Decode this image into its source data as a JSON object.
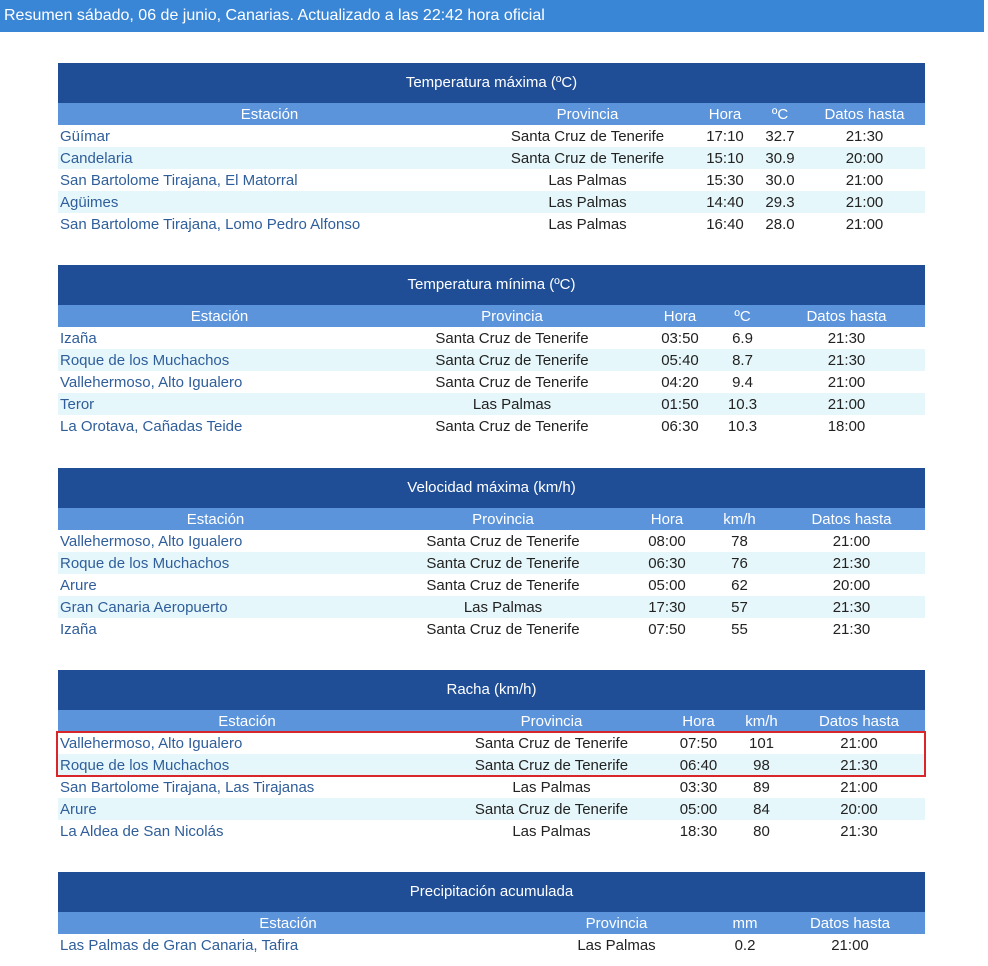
{
  "header": "Resumen sábado, 06 de junio, Canarias. Actualizado a las 22:42 hora oficial",
  "tmax": {
    "title": "Temperatura máxima (ºC)",
    "cols": [
      "Estación",
      "Provincia",
      "Hora",
      "ºC",
      "Datos hasta"
    ],
    "rows": [
      [
        "Güímar",
        "Santa Cruz de Tenerife",
        "17:10",
        "32.7",
        "21:30"
      ],
      [
        "Candelaria",
        "Santa Cruz de Tenerife",
        "15:10",
        "30.9",
        "20:00"
      ],
      [
        "San Bartolome Tirajana, El Matorral",
        "Las Palmas",
        "15:30",
        "30.0",
        "21:00"
      ],
      [
        "Agüimes",
        "Las Palmas",
        "14:40",
        "29.3",
        "21:00"
      ],
      [
        "San Bartolome Tirajana, Lomo Pedro Alfonso",
        "Las Palmas",
        "16:40",
        "28.0",
        "21:00"
      ]
    ]
  },
  "tmin": {
    "title": "Temperatura mínima (ºC)",
    "cols": [
      "Estación",
      "Provincia",
      "Hora",
      "ºC",
      "Datos hasta"
    ],
    "rows": [
      [
        "Izaña",
        "Santa Cruz de Tenerife",
        "03:50",
        "6.9",
        "21:30"
      ],
      [
        "Roque de los Muchachos",
        "Santa Cruz de Tenerife",
        "05:40",
        "8.7",
        "21:30"
      ],
      [
        "Vallehermoso, Alto Igualero",
        "Santa Cruz de Tenerife",
        "04:20",
        "9.4",
        "21:00"
      ],
      [
        "Teror",
        "Las Palmas",
        "01:50",
        "10.3",
        "21:00"
      ],
      [
        "La Orotava, Cañadas Teide",
        "Santa Cruz de Tenerife",
        "06:30",
        "10.3",
        "18:00"
      ]
    ]
  },
  "vmax": {
    "title": "Velocidad máxima (km/h)",
    "cols": [
      "Estación",
      "Provincia",
      "Hora",
      "km/h",
      "Datos hasta"
    ],
    "rows": [
      [
        "Vallehermoso, Alto Igualero",
        "Santa Cruz de Tenerife",
        "08:00",
        "78",
        "21:00"
      ],
      [
        "Roque de los Muchachos",
        "Santa Cruz de Tenerife",
        "06:30",
        "76",
        "21:30"
      ],
      [
        "Arure",
        "Santa Cruz de Tenerife",
        "05:00",
        "62",
        "20:00"
      ],
      [
        "Gran Canaria Aeropuerto",
        "Las Palmas",
        "17:30",
        "57",
        "21:30"
      ],
      [
        "Izaña",
        "Santa Cruz de Tenerife",
        "07:50",
        "55",
        "21:30"
      ]
    ]
  },
  "racha": {
    "title": "Racha (km/h)",
    "cols": [
      "Estación",
      "Provincia",
      "Hora",
      "km/h",
      "Datos hasta"
    ],
    "rows": [
      [
        "Vallehermoso, Alto Igualero",
        "Santa Cruz de Tenerife",
        "07:50",
        "101",
        "21:00"
      ],
      [
        "Roque de los Muchachos",
        "Santa Cruz de Tenerife",
        "06:40",
        "98",
        "21:30"
      ],
      [
        "San Bartolome Tirajana, Las Tirajanas",
        "Las Palmas",
        "03:30",
        "89",
        "21:00"
      ],
      [
        "Arure",
        "Santa Cruz de Tenerife",
        "05:00",
        "84",
        "20:00"
      ],
      [
        "La Aldea de San Nicolás",
        "Las Palmas",
        "18:30",
        "80",
        "21:30"
      ]
    ]
  },
  "precip": {
    "title": "Precipitación acumulada",
    "cols": [
      "Estación",
      "Provincia",
      "mm",
      "Datos hasta"
    ],
    "rows": [
      [
        "Las Palmas de Gran Canaria, Tafira",
        "Las Palmas",
        "0.2",
        "21:00"
      ]
    ]
  }
}
